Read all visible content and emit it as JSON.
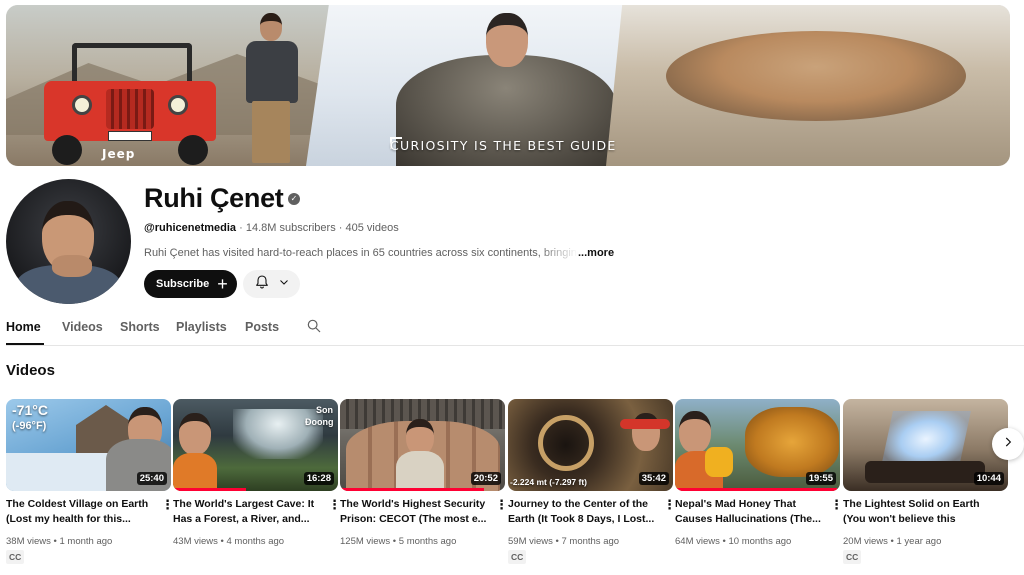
{
  "banner": {
    "tagline": "CURIOSITY IS THE BEST GUIDE",
    "jeep_text": "Jeep"
  },
  "channel": {
    "name": "Ruhi Çenet",
    "handle": "@ruhicenetmedia",
    "subscribers": "14.8M subscribers",
    "videos": "405 videos",
    "separator": "·",
    "description": "Ruhi Çenet has visited hard-to-reach places in 65 countries across six continents, bringing",
    "more_label": "...more",
    "subscribe_label": "Subscribe"
  },
  "tabs": [
    "Home",
    "Videos",
    "Shorts",
    "Playlists",
    "Posts"
  ],
  "section": {
    "title": "Videos"
  },
  "videos": [
    {
      "title": "The Coldest Village on Earth (Lost my health for this...",
      "views": "38M views",
      "age": "1 month ago",
      "duration": "25:40",
      "badge": "CC",
      "overlay_1": "-71°C",
      "overlay_2": "(-96°F)",
      "progress": 0
    },
    {
      "title": "The World's Largest Cave: It Has a Forest, a River, and...",
      "views": "43M views",
      "age": "4 months ago",
      "duration": "16:28",
      "badge": "",
      "overlay_1": "Son",
      "overlay_2": "Đoong",
      "progress": 0.44
    },
    {
      "title": "The World's Highest Security Prison: CECOT (The most e...",
      "views": "125M views",
      "age": "5 months ago",
      "duration": "20:52",
      "badge": "",
      "progress": 0.87
    },
    {
      "title": "Journey to the Center of the Earth (It Took 8 Days, I Lost...",
      "views": "59M views",
      "age": "7 months ago",
      "duration": "35:42",
      "badge": "CC",
      "overlay_1": "-2.224 mt (-7.297 ft)",
      "progress": 0
    },
    {
      "title": "Nepal's Mad Honey That Causes Hallucinations (The...",
      "views": "64M views",
      "age": "10 months ago",
      "duration": "19:55",
      "badge": "",
      "progress": 0.98
    },
    {
      "title": "The Lightest Solid on Earth (You won't believe this exists)",
      "views": "20M views",
      "age": "1 year ago",
      "duration": "10:44",
      "badge": "CC",
      "progress": 0
    }
  ],
  "icons": {
    "verified": "verified-check-icon",
    "bell": "bell-icon",
    "chevron": "chevron-down-icon",
    "search": "search-icon",
    "kebab": "more-vert-icon",
    "next": "chevron-right-icon",
    "plus": "plus-icon"
  },
  "colors": {
    "accent_red": "#ff0033",
    "text_primary": "#0f0f0f",
    "text_secondary": "#606060",
    "chip_bg": "#f2f2f2"
  }
}
